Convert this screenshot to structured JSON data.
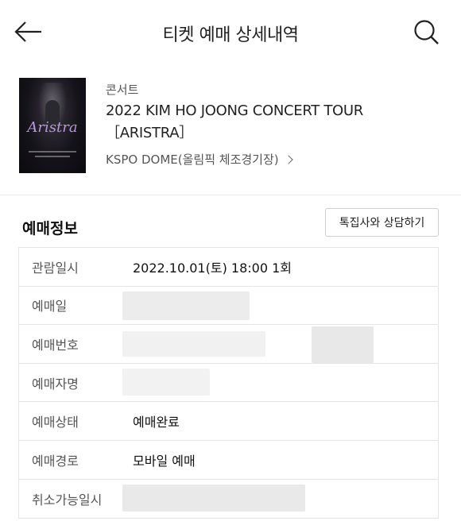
{
  "header": {
    "title": "티켓 예매 상세내역",
    "back_icon": "arrow-left-icon",
    "search_icon": "search-icon"
  },
  "event": {
    "category": "콘서트",
    "title": "2022 KIM HO JOONG CONCERT TOUR ［ARISTRA］",
    "venue": "KSPO DOME(올림픽 체조경기장)",
    "poster_text": "Aristra",
    "poster_accent": "#b896e0"
  },
  "section": {
    "title": "예매정보",
    "consult_button": "톡집사와 상담하기"
  },
  "info_rows": [
    {
      "label": "관람일시",
      "value": "2022.10.01(토) 18:00 1회"
    },
    {
      "label": "예매일",
      "value": ""
    },
    {
      "label": "예매번호",
      "value": ""
    },
    {
      "label": "예매자명",
      "value": ""
    },
    {
      "label": "예매상태",
      "value": "예매완료"
    },
    {
      "label": "예매경로",
      "value": "모바일 예매"
    },
    {
      "label": "취소가능일시",
      "value": ""
    }
  ]
}
